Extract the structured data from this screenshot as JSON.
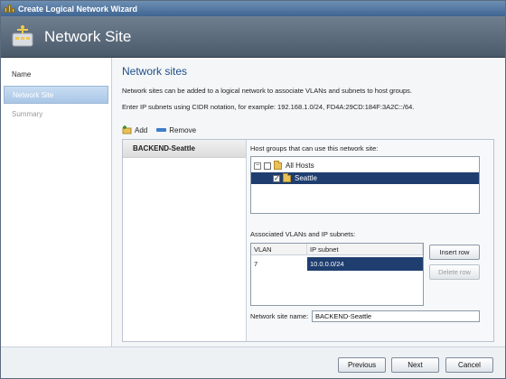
{
  "window": {
    "title": "Create Logical Network Wizard"
  },
  "header": {
    "title": "Network Site"
  },
  "nav": {
    "items": [
      {
        "label": "Name",
        "state": "normal"
      },
      {
        "label": "Network Site",
        "state": "selected"
      },
      {
        "label": "Summary",
        "state": "disabled"
      }
    ]
  },
  "main": {
    "heading": "Network sites",
    "description1": "Network sites can be added to a logical network to associate VLANs and subnets to host groups.",
    "description2": "Enter IP subnets using CIDR notation, for example: 192.168.1.0/24, FD4A:29CD:184F:3A2C::/64.",
    "toolbar": {
      "add_label": "Add",
      "remove_label": "Remove"
    },
    "sites": [
      {
        "name": "BACKEND-Seattle"
      }
    ],
    "host_groups": {
      "label": "Host groups that can use this network site:",
      "tree": [
        {
          "label": "All Hosts",
          "checked": false,
          "expanded": true,
          "selected": false
        },
        {
          "label": "Seattle",
          "checked": true,
          "selected": true
        }
      ]
    },
    "vlans": {
      "label": "Associated VLANs and IP subnets:",
      "columns": [
        "VLAN",
        "IP subnet"
      ],
      "rows": [
        {
          "vlan": "7",
          "subnet": "10.0.0.0/24"
        }
      ],
      "insert_row_label": "Insert row",
      "delete_row_label": "Delete row"
    },
    "site_name": {
      "label": "Network site name:",
      "value": "BACKEND-Seattle"
    }
  },
  "footer": {
    "previous_label": "Previous",
    "next_label": "Next",
    "cancel_label": "Cancel"
  },
  "colors": {
    "accent": "#1f4e89",
    "selection": "#1f3e6f"
  }
}
